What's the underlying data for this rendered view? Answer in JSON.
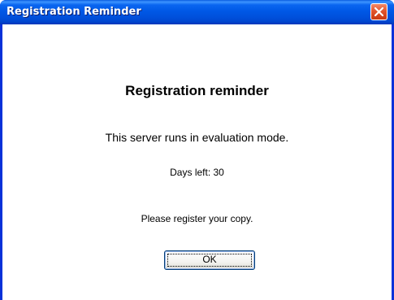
{
  "window": {
    "title": "Registration Reminder",
    "close_icon": "close-icon"
  },
  "content": {
    "heading": "Registration reminder",
    "mode_text": "This server runs in evaluation mode.",
    "days_left_text": "Days left: 30",
    "register_text": "Please register your copy."
  },
  "buttons": {
    "ok_label": "OK"
  },
  "colors": {
    "titlebar": "#0058e6",
    "frame": "#0831d9",
    "close_button": "#e2542c",
    "background": "#ffffff"
  }
}
